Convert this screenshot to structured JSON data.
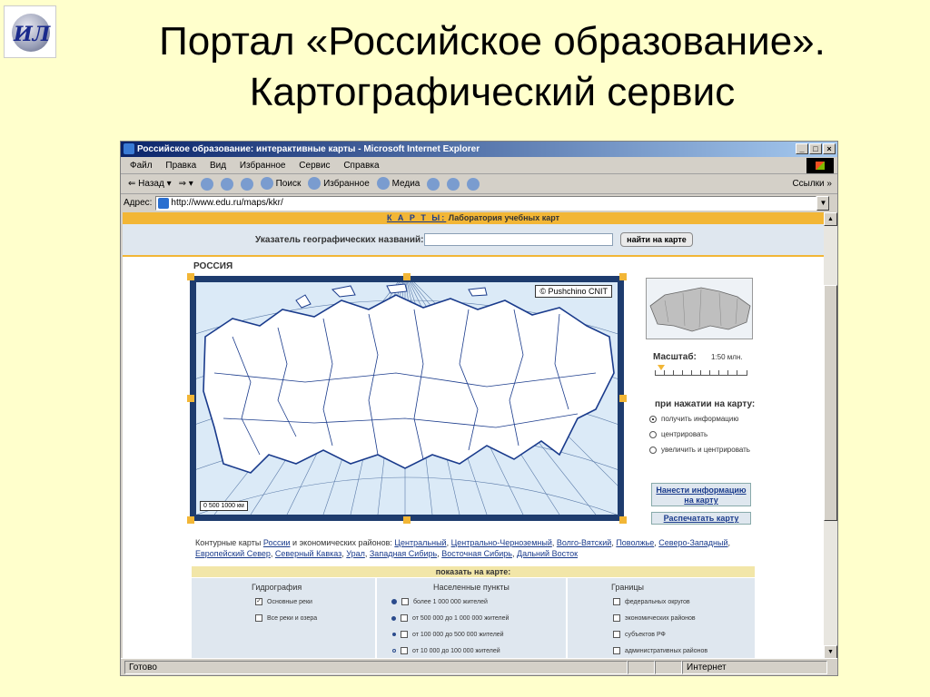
{
  "slide": {
    "title_line1": "Портал «Российское образование».",
    "title_line2": "Картографический сервис"
  },
  "browser": {
    "title": "Российское образование: интерактивные карты - Microsoft Internet Explorer",
    "menu": [
      "Файл",
      "Правка",
      "Вид",
      "Избранное",
      "Сервис",
      "Справка"
    ],
    "toolbar": {
      "back": "Назад",
      "search": "Поиск",
      "favorites": "Избранное",
      "media": "Медиа",
      "links": "Ссылки"
    },
    "address_label": "Адрес:",
    "address_value": "http://www.edu.ru/maps/kkr/",
    "status_left": "Готово",
    "status_zone": "Интернет"
  },
  "page": {
    "kart_link": "К А Р Т Ы:",
    "kart_subtitle": "Лаборатория учебных карт",
    "search_label": "Указатель географических названий:",
    "search_value": "",
    "search_button": "найти на карте",
    "region_title": "РОССИЯ",
    "copyright": "© Pushchino CNIT",
    "scalebar_text": "0  500 1000 км",
    "scale_label": "Масштаб:",
    "scale_value": "1:50 млн.",
    "click_label": "при нажатии на карту:",
    "click_options": [
      {
        "label": "получить информацию",
        "selected": true
      },
      {
        "label": "центрировать",
        "selected": false
      },
      {
        "label": "увеличить и центрировать",
        "selected": false
      }
    ],
    "btn_add_info": "Нанести информацию на карту",
    "btn_print": "Распечатать карту",
    "contour_prefix": "Контурные карты",
    "contour_russia": "России",
    "contour_mid": "и экономических районов:",
    "regions": [
      "Центральный",
      "Центрально-Черноземный",
      "Волго-Вятский",
      "Поволжье",
      "Северо-Западный",
      "Европейский Север",
      "Северный Кавказ",
      "Урал",
      "Западная Сибирь",
      "Восточная Сибирь",
      "Дальний Восток"
    ],
    "show_on_map": "показать на карте:",
    "hydro": {
      "head": "Гидрография",
      "items": [
        {
          "label": "Основные реки",
          "checked": true
        },
        {
          "label": "Все реки и озера",
          "checked": false
        }
      ]
    },
    "settlements": {
      "head": "Населенные пункты",
      "items": [
        {
          "label": "более 1 000 000 жителей",
          "checked": false
        },
        {
          "label": "от 500 000 до 1 000 000 жителей",
          "checked": false
        },
        {
          "label": "от 100 000 до 500 000 жителей",
          "checked": false
        },
        {
          "label": "от 10 000 до 100 000 жителей",
          "checked": false
        }
      ]
    },
    "borders": {
      "head": "Границы",
      "items": [
        {
          "label": "федеральных округов",
          "checked": false
        },
        {
          "label": "экономических районов",
          "checked": false
        },
        {
          "label": "субъектов РФ",
          "checked": false
        },
        {
          "label": "административных районов",
          "checked": false
        }
      ]
    }
  },
  "colors": {
    "slide_bg": "#ffffcc",
    "accent_orange": "#f2b636",
    "map_frame": "#1e3c6e",
    "map_water": "#dbeaf7",
    "panel_blue": "#dfe7ef"
  }
}
